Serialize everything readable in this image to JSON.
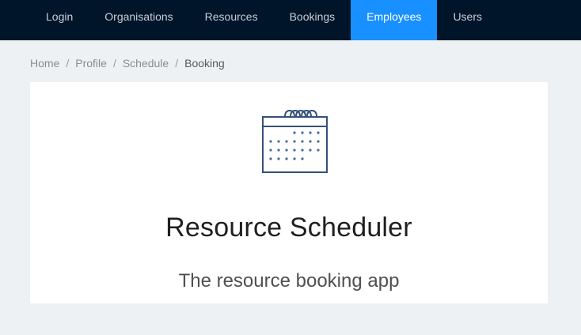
{
  "nav": {
    "items": [
      {
        "label": "Login"
      },
      {
        "label": "Organisations"
      },
      {
        "label": "Resources"
      },
      {
        "label": "Bookings"
      },
      {
        "label": "Employees",
        "active": true
      },
      {
        "label": "Users"
      }
    ]
  },
  "breadcrumb": {
    "items": [
      "Home",
      "Profile",
      "Schedule",
      "Booking"
    ],
    "separator": "/"
  },
  "hero": {
    "icon": "calendar-icon",
    "title": "Resource Scheduler",
    "subtitle": "The resource booking app"
  },
  "colors": {
    "nav_bg": "#001529",
    "nav_active": "#1890ff",
    "page_bg": "#eef1f4",
    "icon_stroke": "#34507a"
  }
}
